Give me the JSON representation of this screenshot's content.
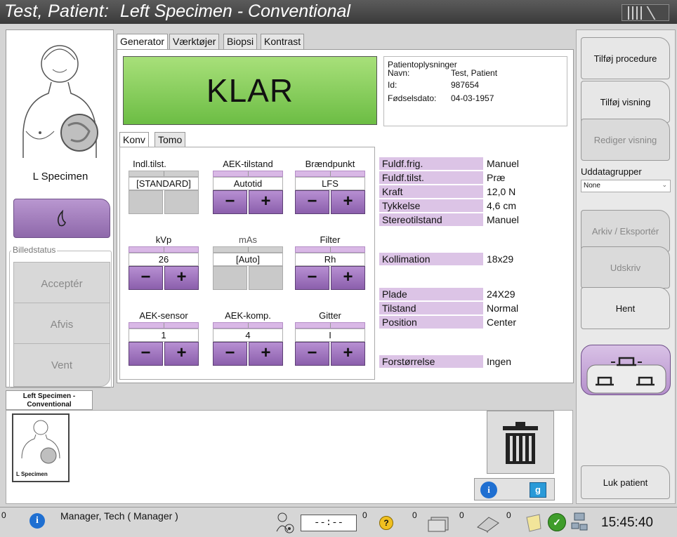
{
  "title": {
    "patient": "Test, Patient:",
    "procedure": "Left Specimen - Conventional"
  },
  "tabs": [
    "Generator",
    "Værktøjer",
    "Biopsi",
    "Kontrast"
  ],
  "status_display": "KLAR",
  "patient_info": {
    "heading": "Patientoplysninger",
    "rows": [
      {
        "label": "Navn:",
        "value": "Test, Patient"
      },
      {
        "label": "Id:",
        "value": "987654"
      },
      {
        "label": "Fødselsdato:",
        "value": "04-03-1957"
      }
    ]
  },
  "view_name": "L Specimen",
  "image_status": {
    "legend": "Billedstatus",
    "accept": "Acceptér",
    "reject": "Afvis",
    "pend": "Vent"
  },
  "subtabs": [
    "Konv",
    "Tomo"
  ],
  "controls": {
    "mode": {
      "label": "Indl.tilst.",
      "value": "[STANDARD]"
    },
    "aec_mode": {
      "label": "AEK-tilstand",
      "value": "Autotid"
    },
    "focal": {
      "label": "Brændpunkt",
      "value": "LFS"
    },
    "kvp": {
      "label": "kVp",
      "value": "26"
    },
    "mas": {
      "label": "mAs",
      "value": "[Auto]"
    },
    "filter": {
      "label": "Filter",
      "value": "Rh"
    },
    "aec_sensor": {
      "label": "AEK-sensor",
      "value": "1"
    },
    "aec_comp": {
      "label": "AEK-komp.",
      "value": "4"
    },
    "grid": {
      "label": "Gitter",
      "value": "I"
    },
    "minus": "−",
    "plus": "+"
  },
  "settings": [
    {
      "label": "Fuldf.frig.",
      "value": "Manuel"
    },
    {
      "label": "Fuldf.tilst.",
      "value": "Præ"
    },
    {
      "label": "Kraft",
      "value": "12,0 N"
    },
    {
      "label": "Tykkelse",
      "value": "4,6 cm"
    },
    {
      "label": "Stereotilstand",
      "value": "Manuel"
    },
    {
      "label": "Kollimation",
      "value": "18x29"
    },
    {
      "label": "Plade",
      "value": "24X29"
    },
    {
      "label": "Tilstand",
      "value": "Normal"
    },
    {
      "label": "Position",
      "value": "Center"
    },
    {
      "label": "Forstørrelse",
      "value": "Ingen"
    }
  ],
  "right_panel": {
    "add_procedure": "Tilføj procedure",
    "add_view": "Tilføj visning",
    "edit_view": "Rediger visning",
    "output_groups_label": "Uddatagrupper",
    "output_groups_value": "None",
    "archive_export": "Arkiv / Eksportér",
    "print": "Udskriv",
    "retrieve": "Hent",
    "close_patient": "Luk patient"
  },
  "sequence_tab": "Left Specimen - Conventional",
  "thumbnail_label": "L Specimen",
  "status_bar": {
    "user": "Manager, Tech ( Manager )",
    "counter_left": "0",
    "display": "--:--",
    "counts": [
      "0",
      "0",
      "0",
      "0",
      "0"
    ],
    "clock": "15:45:40"
  },
  "colors": {
    "accent_purple": "#9a74b8",
    "ready_green": "#8fd35f",
    "title_bar": "#4a4a4a"
  }
}
